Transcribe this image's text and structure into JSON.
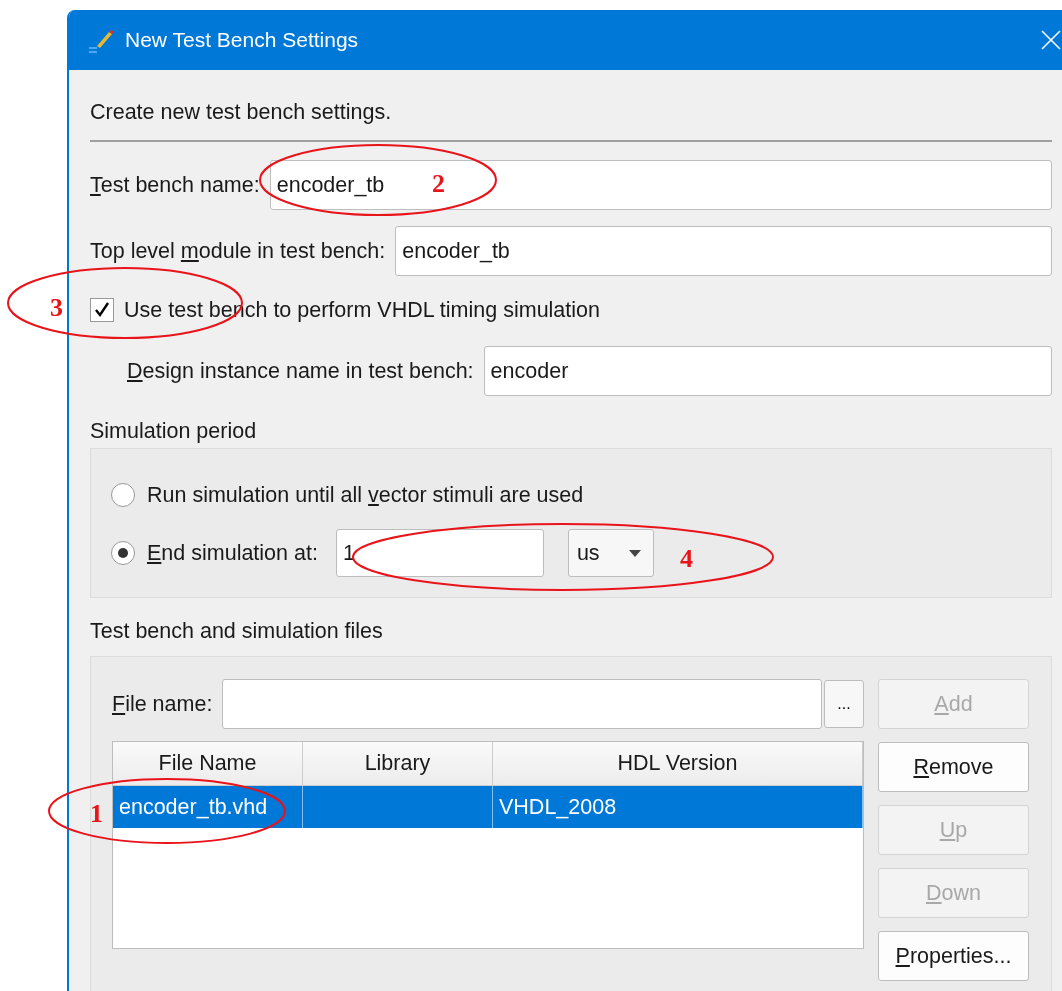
{
  "window": {
    "title": "New Test Bench Settings"
  },
  "intro": "Create new test bench settings.",
  "name_fields": [
    {
      "label": [
        {
          "text": "T",
          "underline": true
        },
        {
          "text": "est bench name:",
          "underline": false
        }
      ],
      "value": "encoder_tb"
    },
    {
      "label": [
        {
          "text": "Top level ",
          "underline": false
        },
        {
          "text": "m",
          "underline": true
        },
        {
          "text": "odule in test bench:",
          "underline": false
        }
      ],
      "value": "encoder_tb"
    }
  ],
  "timing_checkbox": {
    "label": "Use test bench to perform VHDL timing simulation",
    "checked": true
  },
  "instance_field": {
    "label": [
      {
        "text": "D",
        "underline": true
      },
      {
        "text": "esign instance name in test bench:",
        "underline": false
      }
    ],
    "value": "encoder"
  },
  "simulation_period": {
    "title": "Simulation period",
    "options": [
      {
        "label": [
          {
            "text": "Run simulation until all ",
            "underline": false
          },
          {
            "text": "v",
            "underline": true
          },
          {
            "text": "ector stimuli are used",
            "underline": false
          }
        ],
        "selected": false
      },
      {
        "label": [
          {
            "text": "E",
            "underline": true
          },
          {
            "text": "nd simulation at:",
            "underline": false
          }
        ],
        "selected": true
      }
    ],
    "end_value": "1",
    "unit": "us"
  },
  "files": {
    "title": "Test bench and simulation files",
    "file_name_label": [
      {
        "text": "F",
        "underline": true
      },
      {
        "text": "ile name:",
        "underline": false
      }
    ],
    "browse_button": "...",
    "columns": [
      "File Name",
      "Library",
      "HDL Version"
    ],
    "rows": [
      {
        "cells": [
          "encoder_tb.vhd",
          "",
          "VHDL_2008"
        ],
        "selected": true
      }
    ],
    "buttons": [
      {
        "label": [
          {
            "text": "A",
            "underline": true
          },
          {
            "text": "dd",
            "underline": false
          }
        ],
        "disabled": true
      },
      {
        "label": [
          {
            "text": "R",
            "underline": true
          },
          {
            "text": "emove",
            "underline": false
          }
        ],
        "disabled": false
      },
      {
        "label": [
          {
            "text": "U",
            "underline": true
          },
          {
            "text": "p",
            "underline": false
          }
        ],
        "disabled": true
      },
      {
        "label": [
          {
            "text": "D",
            "underline": true
          },
          {
            "text": "own",
            "underline": false
          }
        ],
        "disabled": true
      },
      {
        "label": [
          {
            "text": "P",
            "underline": true
          },
          {
            "text": "roperties...",
            "underline": false
          }
        ],
        "disabled": false
      }
    ]
  },
  "annotations": [
    {
      "number": "1"
    },
    {
      "number": "2"
    },
    {
      "number": "3"
    },
    {
      "number": "4"
    }
  ]
}
